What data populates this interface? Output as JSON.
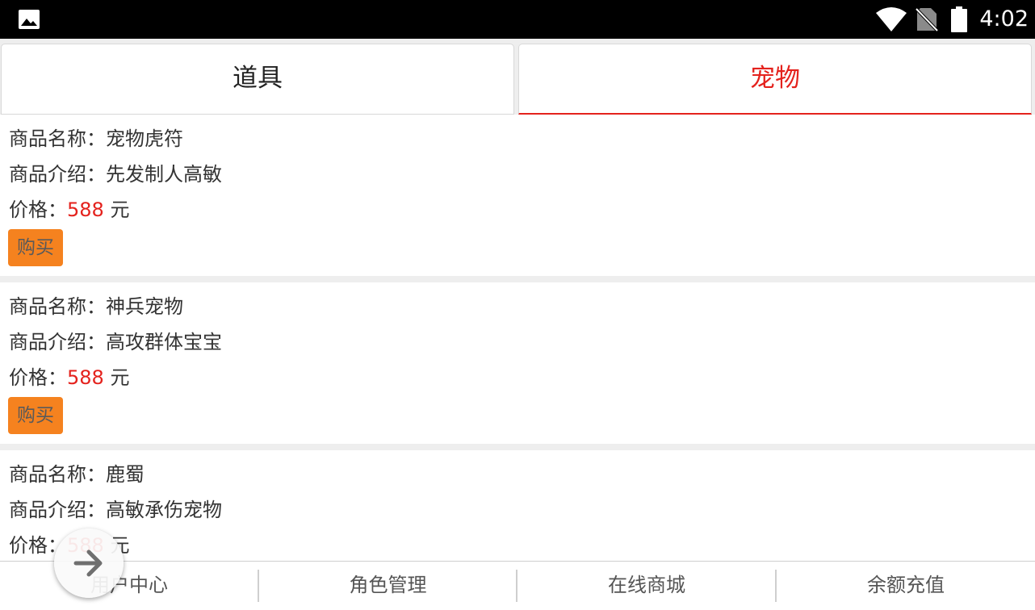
{
  "status_bar": {
    "time": "4:02",
    "icons": [
      "gallery-icon",
      "wifi-icon",
      "no-sim-icon",
      "battery-icon"
    ]
  },
  "tabs": [
    {
      "label": "道具",
      "active": false
    },
    {
      "label": "宠物",
      "active": true
    }
  ],
  "labels": {
    "name_prefix": "商品名称：",
    "intro_prefix": "商品介绍：",
    "price_prefix": "价格：",
    "currency": "元",
    "buy": "购买"
  },
  "products": [
    {
      "name": "宠物虎符",
      "intro": "先发制人高敏",
      "price": "588"
    },
    {
      "name": "神兵宠物",
      "intro": "高攻群体宝宝",
      "price": "588"
    },
    {
      "name": "鹿蜀",
      "intro": "高敏承伤宠物",
      "price": "588"
    }
  ],
  "bottom_nav": [
    "用户中心",
    "角色管理",
    "在线商城",
    "余额充值"
  ],
  "floating_button": {
    "icon": "arrow-right-icon"
  },
  "colors": {
    "accent_red": "#e4221d",
    "buy_button": "#f5821f",
    "status_bar": "#000000",
    "separator": "#eeeeee"
  }
}
